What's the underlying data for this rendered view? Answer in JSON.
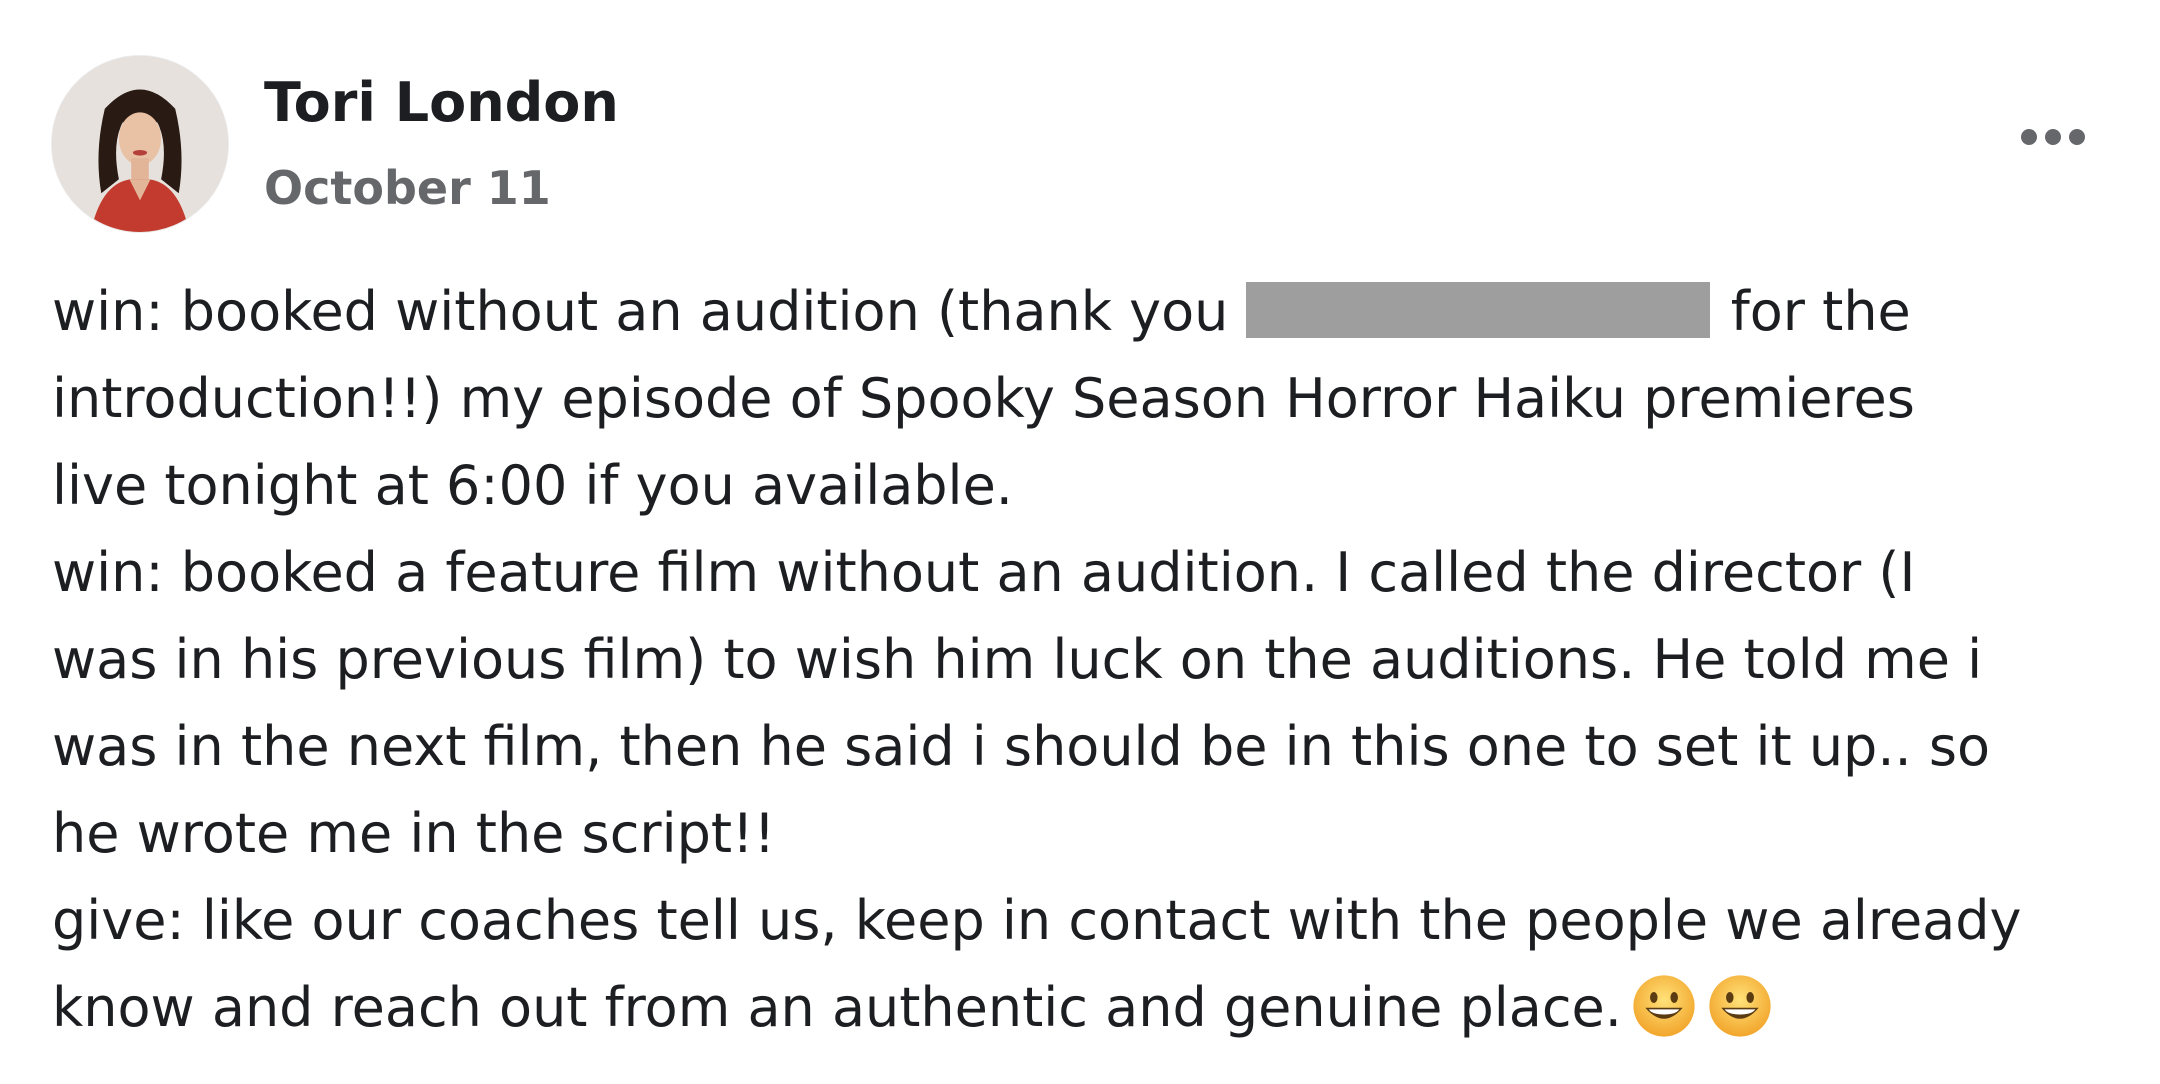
{
  "post": {
    "author": "Tori London",
    "date": "October 11",
    "more_label": "•••",
    "body": {
      "line1_before": "win:  booked without an audition (thank you ",
      "line1_after": " for the",
      "line2": "introduction!!)  my episode of Spooky Season Horror Haiku premieres",
      "line3": "live tonight at 6:00 if you available.",
      "line4": "win:  booked a feature film without an audition.  I called the director (I",
      "line5": "was in his previous film) to wish him luck on the auditions.  He told me i",
      "line6": "was in the next film, then he said i should be in this one to set it up..  so",
      "line7": "he wrote me in the script!!",
      "line8": "give: like our coaches tell us, keep in contact with the people we already",
      "line9": "know and reach out from an authentic and genuine place."
    },
    "emojis": [
      "grinning-face-icon",
      "grinning-face-icon"
    ]
  },
  "colors": {
    "text": "#1c1e21",
    "secondary_text": "#65676b",
    "redaction": "#9e9e9e",
    "emoji_face": "#f7c23b"
  }
}
